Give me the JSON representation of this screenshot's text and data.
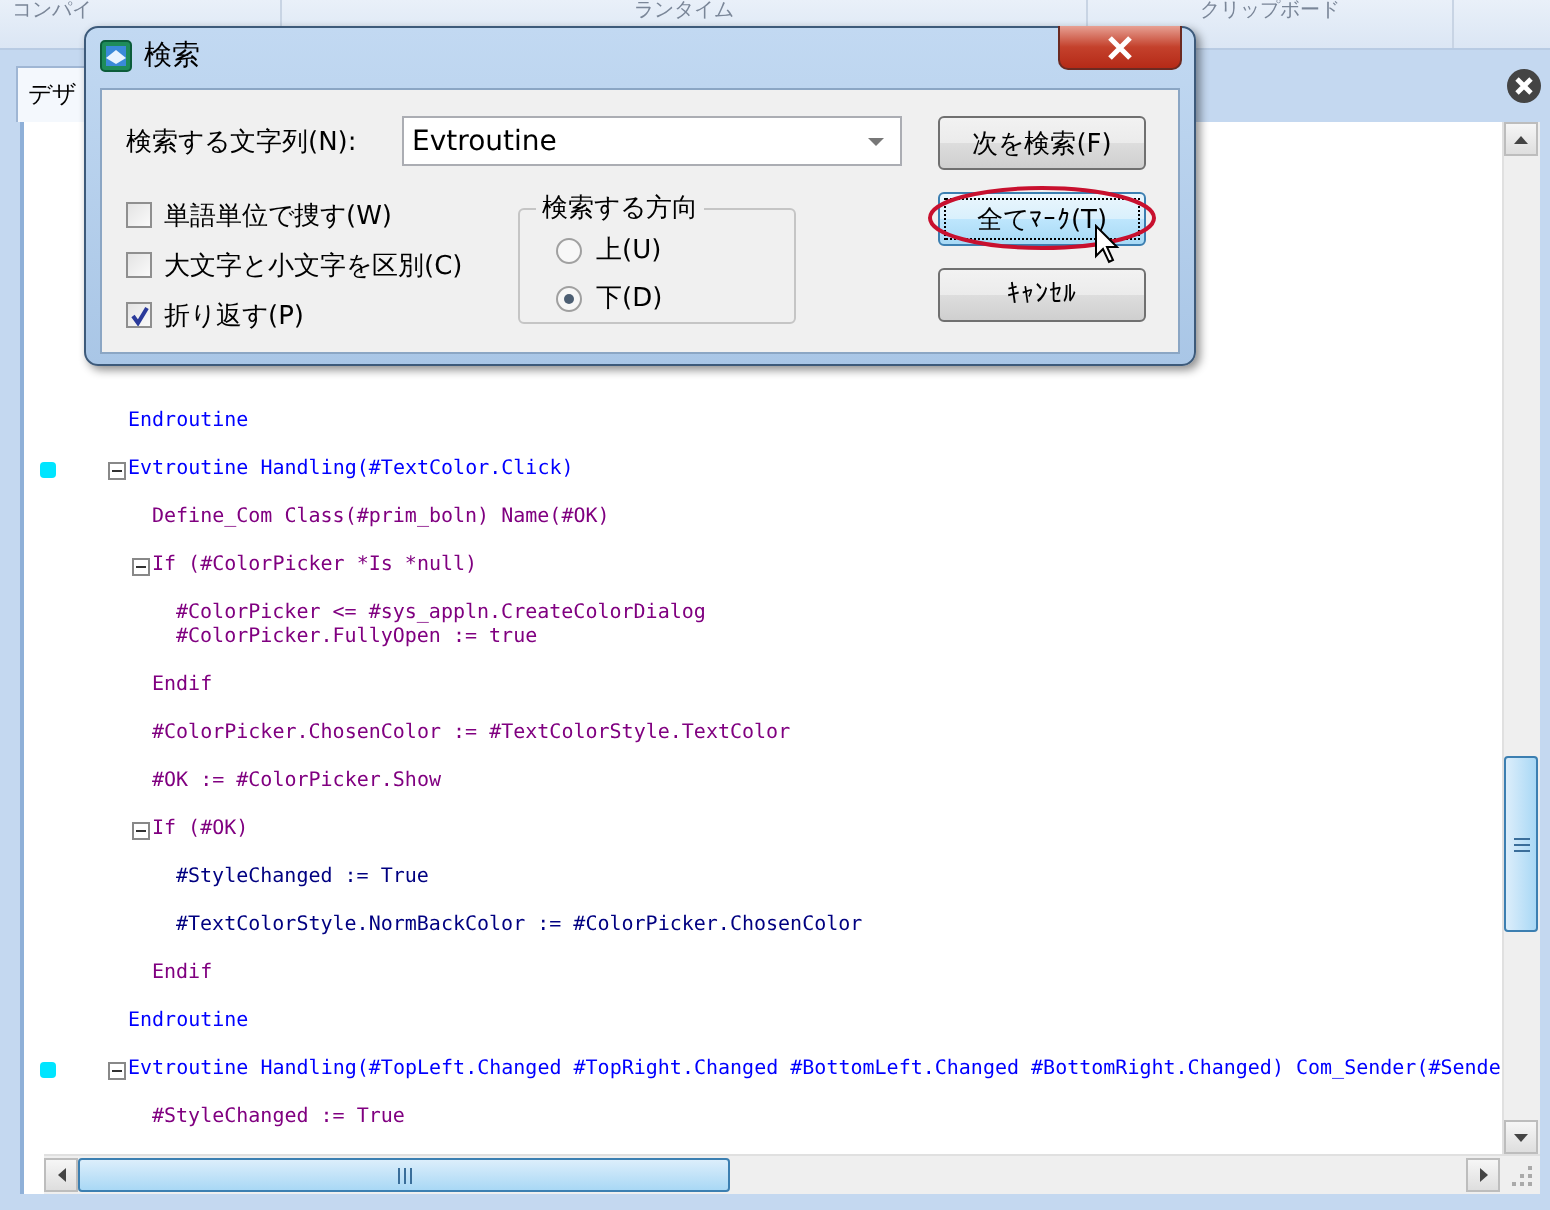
{
  "ribbon": {
    "groups": [
      "コンパイ",
      "ランタイム",
      "クリップボード"
    ]
  },
  "tab": {
    "label": "デザ"
  },
  "code": [
    {
      "kind": "routine",
      "texts": [
        "Endroutine"
      ]
    },
    {
      "kind": "routine",
      "texts": [
        "Evtroutine Handling(#TextColor.Click)"
      ],
      "breakpoint": true,
      "expanded": true,
      "children": [
        {
          "kind": "statement",
          "texts": [
            "Define_Com Class(#prim_boln) Name(#OK)"
          ]
        },
        {
          "kind": "statement",
          "texts": [
            "If (#ColorPicker *Is *null)"
          ],
          "expanded": true,
          "children": [
            {
              "kind": "statement",
              "texts": [
                "#ColorPicker <= #sys_appln.CreateColorDialog",
                "#ColorPicker.FullyOpen := true"
              ]
            }
          ]
        },
        {
          "kind": "statement",
          "texts": [
            "Endif"
          ]
        },
        {
          "kind": "statement",
          "texts": [
            "#ColorPicker.ChosenColor := #TextColorStyle.TextColor"
          ]
        },
        {
          "kind": "statement",
          "texts": [
            "#OK := #ColorPicker.Show"
          ]
        },
        {
          "kind": "statement",
          "texts": [
            "If (#OK)"
          ],
          "expanded": true,
          "children": [
            {
              "kind": "assign",
              "texts": [
                "#StyleChanged := True"
              ]
            },
            {
              "kind": "assign",
              "texts": [
                "#TextColorStyle.NormBackColor := #ColorPicker.ChosenColor"
              ]
            }
          ]
        },
        {
          "kind": "statement",
          "texts": [
            "Endif"
          ]
        }
      ]
    },
    {
      "kind": "routine",
      "texts": [
        "Endroutine"
      ]
    },
    {
      "kind": "routine",
      "texts": [
        "Evtroutine Handling(#TopLeft.Changed #TopRight.Changed #BottomLeft.Changed #BottomRight.Changed) Com_Sender(#Sende"
      ],
      "breakpoint": true,
      "expanded": true,
      "children": [
        {
          "kind": "statement",
          "texts": [
            "#StyleChanged := True"
          ]
        }
      ]
    }
  ],
  "dialog": {
    "title": "検索",
    "search_label": "検索する文字列(N):",
    "search_value": "Evtroutine",
    "options": [
      {
        "label": "単語単位で捜す(W)",
        "checked": false
      },
      {
        "label": "大文字と小文字を区別(C)",
        "checked": false
      },
      {
        "label": "折り返す(P)",
        "checked": true
      }
    ],
    "direction": {
      "title": "検索する方向",
      "options": [
        {
          "label": "上(U)",
          "selected": false
        },
        {
          "label": "下(D)",
          "selected": true
        }
      ]
    },
    "buttons": [
      {
        "label": "次を検索(F)",
        "focused": false,
        "annotated": false
      },
      {
        "label": "全てﾏｰｸ(T)",
        "focused": true,
        "annotated": true
      },
      {
        "label": "ｷｬﾝｾﾙ",
        "focused": false,
        "annotated": false
      }
    ]
  }
}
